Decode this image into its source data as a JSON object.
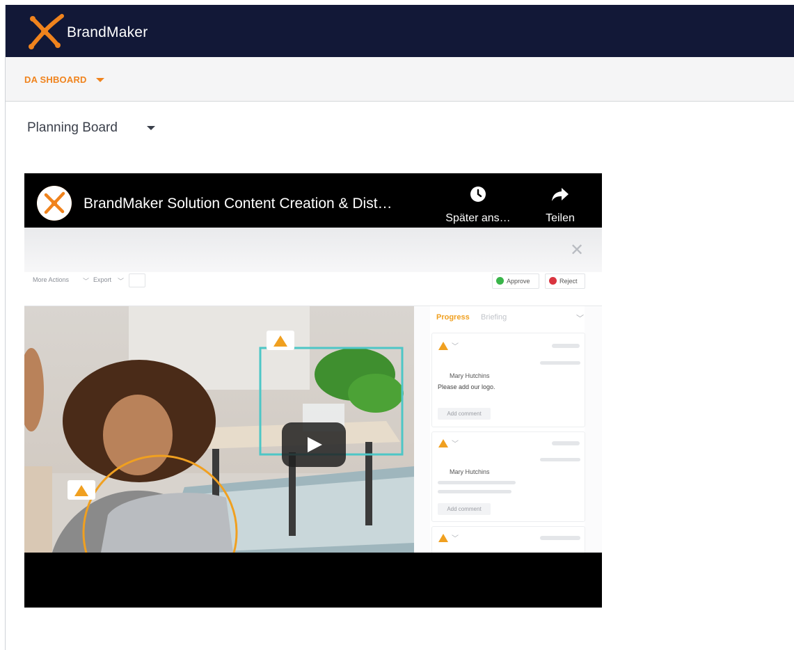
{
  "header": {
    "brand_name": "BrandMaker",
    "colors": {
      "topbar": "#121837",
      "accent": "#f0831d"
    }
  },
  "dashboard": {
    "label": "DA SHBOARD"
  },
  "board": {
    "title": "Planning Board"
  },
  "video": {
    "title": "BrandMaker Solution Content Creation & Dist…",
    "watch_later_label": "Später ans…",
    "share_label": "Teilen",
    "icons": [
      "clock-icon",
      "share-arrow-icon",
      "play-icon",
      "close-icon"
    ],
    "thumbnail": {
      "toolbar": {
        "more_actions": "More Actions",
        "export": "Export",
        "approve": "Approve",
        "reject": "Reject"
      },
      "panel": {
        "tab_progress": "Progress",
        "tab_briefing": "Briefing",
        "cards": [
          {
            "author": "Mary Hutchins",
            "text": "Please add our logo.",
            "button": "Add comment"
          },
          {
            "author": "Mary Hutchins",
            "text": "",
            "button": "Add comment"
          }
        ]
      }
    }
  }
}
